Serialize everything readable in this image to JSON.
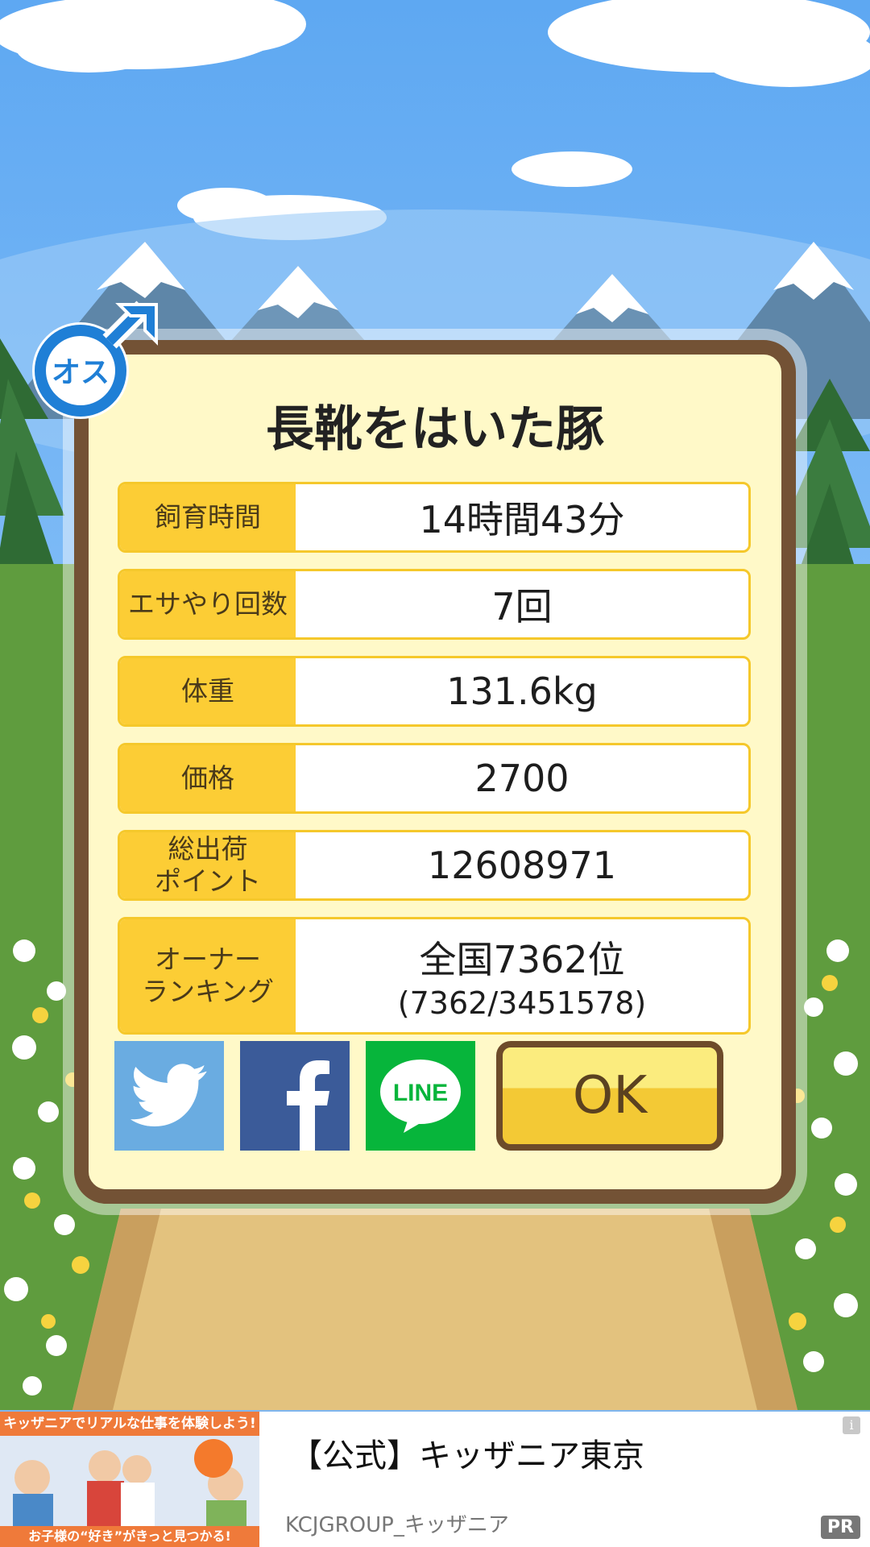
{
  "pig": {
    "name": "長靴をはいた豚",
    "gender_badge": "オス",
    "gender_icon": "male-symbol-icon"
  },
  "stats": [
    {
      "label": "飼育時間",
      "value": "14時間43分"
    },
    {
      "label": "エサやり回数",
      "value": "7回"
    },
    {
      "label": "体重",
      "value": "131.6kg"
    },
    {
      "label": "価格",
      "value": "2700"
    },
    {
      "label": "総出荷\nポイント",
      "value": "12608971"
    },
    {
      "label": "オーナー\nランキング",
      "value": "全国7362位",
      "sub": "(7362/3451578)"
    }
  ],
  "share": {
    "twitter_icon": "twitter-bird-icon",
    "facebook_icon": "facebook-f-icon",
    "line_label": "LINE"
  },
  "ok_label": "OK",
  "ad": {
    "banner_top": "キッザニアでリアルな仕事を体験しよう!",
    "banner_bottom": "お子様の“好き”がきっと見つかる!",
    "title": "【公式】キッザニア東京",
    "advertiser": "KCJGROUP_キッザニア",
    "info_label": "i",
    "pr_label": "PR"
  },
  "colors": {
    "sky": "#7fb6ee",
    "dialog_bg": "#fff9c8",
    "dialog_border": "#735235",
    "label_bg": "#fccd35",
    "ok_top": "#fbec7e",
    "ok_bottom": "#f3c935",
    "twitter": "#6aace1",
    "facebook": "#3b5b99",
    "line": "#07b53b",
    "badge_blue": "#1f7fd6"
  }
}
